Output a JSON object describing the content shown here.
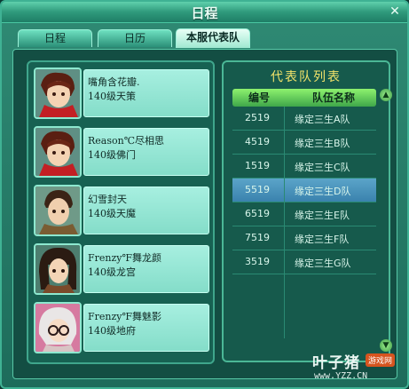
{
  "window": {
    "title": "日程",
    "close_glyph": "✕"
  },
  "tabs": [
    {
      "label": "日程"
    },
    {
      "label": "日历"
    },
    {
      "label": "本服代表队",
      "active": true
    }
  ],
  "members": [
    {
      "name": "嘴角含花瓣.",
      "level": "140级天策"
    },
    {
      "name": "Reason℃尽相思",
      "level": "140级佛门"
    },
    {
      "name": "幻雪封天",
      "level": "140级天魔"
    },
    {
      "name": "Frenzy℉舞龙颜",
      "level": "140级龙宫"
    },
    {
      "name": "Frenzy℉舞魅影",
      "level": "140级地府"
    }
  ],
  "teams": {
    "title": "代表队列表",
    "headers": {
      "id": "编号",
      "name": "队伍名称"
    },
    "rows": [
      {
        "id": "2519",
        "name": "缘定三生A队"
      },
      {
        "id": "4519",
        "name": "缘定三生B队"
      },
      {
        "id": "1519",
        "name": "缘定三生C队"
      },
      {
        "id": "5519",
        "name": "缘定三生D队",
        "selected": true
      },
      {
        "id": "6519",
        "name": "缘定三生E队"
      },
      {
        "id": "7519",
        "name": "缘定三生F队"
      },
      {
        "id": "3519",
        "name": "缘定三生G队"
      }
    ]
  },
  "watermark": {
    "main": "叶子猪",
    "badge": "游戏网",
    "url": "www.YZZ.CN"
  }
}
